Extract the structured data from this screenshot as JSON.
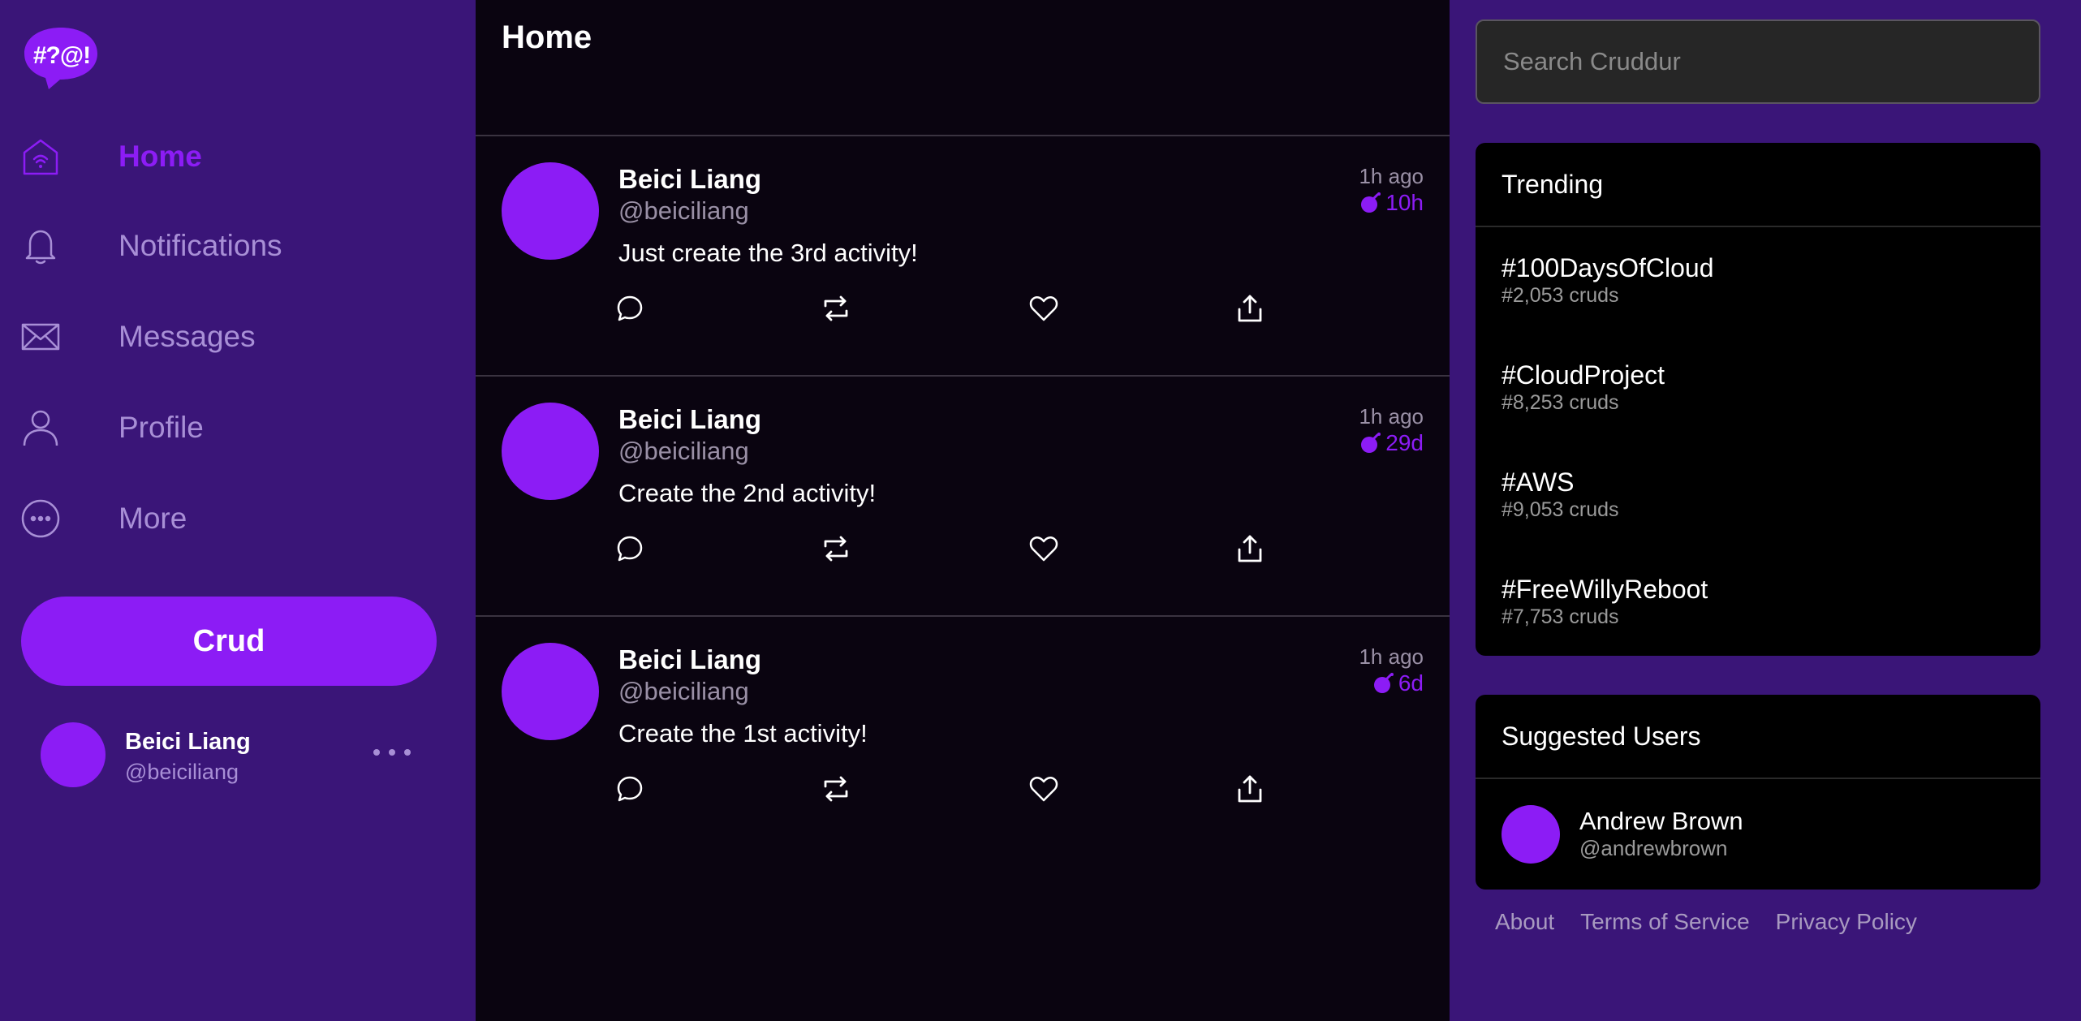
{
  "app": {
    "logo_text": "#?@!",
    "accent_color": "#8c1cf5"
  },
  "sidebar": {
    "items": [
      {
        "label": "Home",
        "icon": "home-icon",
        "active": true
      },
      {
        "label": "Notifications",
        "icon": "bell-icon",
        "active": false
      },
      {
        "label": "Messages",
        "icon": "mail-icon",
        "active": false
      },
      {
        "label": "Profile",
        "icon": "user-icon",
        "active": false
      },
      {
        "label": "More",
        "icon": "more-circle-icon",
        "active": false
      }
    ],
    "crud_label": "Crud",
    "profile": {
      "name": "Beici Liang",
      "handle": "@beiciliang"
    }
  },
  "feed": {
    "title": "Home",
    "activities": [
      {
        "name": "Beici Liang",
        "handle": "@beiciliang",
        "message": "Just create the 3rd activity!",
        "time_ago": "1h ago",
        "expires": "10h"
      },
      {
        "name": "Beici Liang",
        "handle": "@beiciliang",
        "message": "Create the 2nd activity!",
        "time_ago": "1h ago",
        "expires": "29d"
      },
      {
        "name": "Beici Liang",
        "handle": "@beiciliang",
        "message": "Create the 1st activity!",
        "time_ago": "1h ago",
        "expires": "6d"
      }
    ]
  },
  "search": {
    "placeholder": "Search Cruddur"
  },
  "trending": {
    "title": "Trending",
    "items": [
      {
        "name": "#100DaysOfCloud",
        "count": "#2,053 cruds"
      },
      {
        "name": "#CloudProject",
        "count": "#8,253 cruds"
      },
      {
        "name": "#AWS",
        "count": "#9,053 cruds"
      },
      {
        "name": "#FreeWillyReboot",
        "count": "#7,753 cruds"
      }
    ]
  },
  "suggested": {
    "title": "Suggested Users",
    "users": [
      {
        "name": "Andrew Brown",
        "handle": "@andrewbrown"
      }
    ]
  },
  "footer": {
    "about": "About",
    "terms": "Terms of Service",
    "privacy": "Privacy Policy"
  }
}
